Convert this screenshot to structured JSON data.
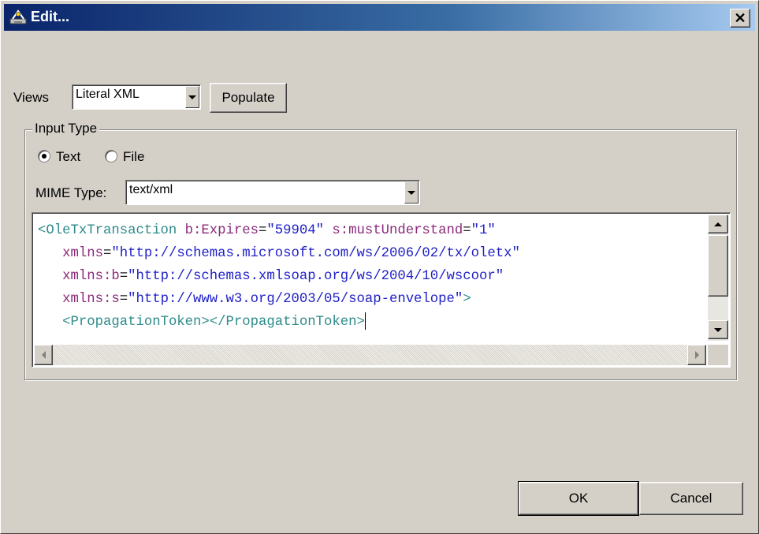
{
  "window": {
    "title": "Edit...",
    "close_glyph": "✕"
  },
  "views": {
    "label": "Views",
    "selected": "Literal XML",
    "populate_label": "Populate"
  },
  "input_type": {
    "legend": "Input Type",
    "options": [
      {
        "label": "Text",
        "checked": true
      },
      {
        "label": "File",
        "checked": false
      }
    ]
  },
  "mime": {
    "label": "MIME Type:",
    "selected": "text/xml"
  },
  "editor": {
    "lines": [
      [
        [
          "tag",
          "<OleTxTransaction "
        ],
        [
          "attr",
          "b:Expires"
        ],
        [
          "punct",
          "="
        ],
        [
          "val",
          "\"59904\""
        ],
        [
          "punct",
          " "
        ],
        [
          "attr",
          "s:mustUnderstand"
        ],
        [
          "punct",
          "="
        ],
        [
          "val",
          "\"1\""
        ]
      ],
      [
        [
          "punct",
          "   "
        ],
        [
          "attr",
          "xmlns"
        ],
        [
          "punct",
          "="
        ],
        [
          "val",
          "\"http://schemas.microsoft.com/ws/2006/02/tx/oletx\""
        ]
      ],
      [
        [
          "punct",
          "   "
        ],
        [
          "attr",
          "xmlns:b"
        ],
        [
          "punct",
          "="
        ],
        [
          "val",
          "\"http://schemas.xmlsoap.org/ws/2004/10/wscoor\""
        ]
      ],
      [
        [
          "punct",
          "   "
        ],
        [
          "attr",
          "xmlns:s"
        ],
        [
          "punct",
          "="
        ],
        [
          "val",
          "\"http://www.w3.org/2003/05/soap-envelope\""
        ],
        [
          "tag",
          ">"
        ]
      ],
      [
        [
          "punct",
          "   "
        ],
        [
          "tag",
          "<PropagationToken></PropagationToken>"
        ]
      ]
    ],
    "colors": {
      "tag": "#2e8b8b",
      "attr": "#8b2a7a",
      "val": "#2020c8"
    }
  },
  "buttons": {
    "ok": "OK",
    "cancel": "Cancel"
  },
  "colors": {
    "titlebar_start": "#0a246a",
    "titlebar_end": "#a6caf0",
    "face": "#d4d0c8"
  }
}
